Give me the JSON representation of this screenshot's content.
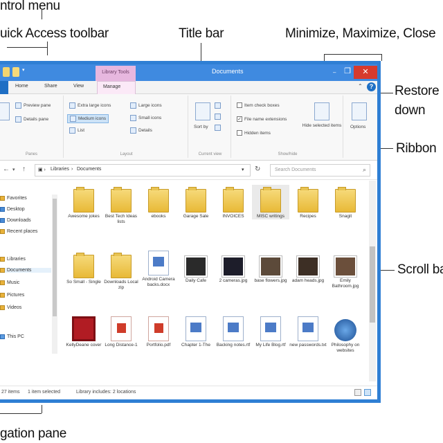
{
  "annotations": {
    "control_menu": "ntrol menu",
    "quick_access": "uick Access toolbar",
    "title_bar": "Title bar",
    "min_max_close": "Minimize, Maximize, Close",
    "restore_down_1": "Restore",
    "restore_down_2": "down",
    "ribbon": "Ribbon",
    "scroll_bar": "Scroll bar",
    "navigation_pane": "gation pane"
  },
  "window": {
    "title": "Documents",
    "contextual_tab": "Library Tools",
    "colors": {
      "frame": "#2f7fd4",
      "close": "#d73a2d",
      "contextual": "#e7b7df"
    }
  },
  "ribbon_tabs": [
    "Home",
    "Share",
    "View"
  ],
  "manage_tab": "Manage",
  "ribbon": {
    "panes": {
      "preview": "Preview pane",
      "details": "Details pane",
      "label": "Panes"
    },
    "layout": {
      "items": [
        "Extra large icons",
        "Large icons",
        "Medium icons",
        "Small icons",
        "List",
        "Details"
      ],
      "label": "Layout"
    },
    "current_view": {
      "sort_by": "Sort by",
      "label": "Current view"
    },
    "show_hide": {
      "item_check_boxes": "Item check boxes",
      "file_name_extensions": "File name extensions",
      "hidden_items": "Hidden items",
      "hide_selected": "Hide selected items",
      "label": "Show/hide"
    },
    "options": "Options"
  },
  "address": {
    "segments": [
      "Libraries",
      "Documents"
    ],
    "search_placeholder": "Search Documents"
  },
  "nav_pane": [
    "Favorites",
    "Desktop",
    "Downloads",
    "Recent places",
    "Libraries",
    "Documents",
    "Music",
    "Pictures",
    "Videos",
    "This PC"
  ],
  "items": [
    {
      "label": "Awesome jokes",
      "kind": "folder"
    },
    {
      "label": "Best Tech Ideas lists",
      "kind": "folder"
    },
    {
      "label": "ebooks",
      "kind": "folder"
    },
    {
      "label": "Garage Sale",
      "kind": "folder"
    },
    {
      "label": "INVOICES",
      "kind": "folder"
    },
    {
      "label": "MISC writings",
      "kind": "folder"
    },
    {
      "label": "Recipes",
      "kind": "folder"
    },
    {
      "label": "Snagit",
      "kind": "folder"
    },
    {
      "label": "So Small - Single",
      "kind": "folder"
    },
    {
      "label": "Downloads Local zip",
      "kind": "folder"
    },
    {
      "label": "Android Camera backs.docx",
      "kind": "doc"
    },
    {
      "label": "Daily Cafe",
      "kind": "photo"
    },
    {
      "label": "2 cameras.jpg",
      "kind": "photo"
    },
    {
      "label": "base flowers.jpg",
      "kind": "photo"
    },
    {
      "label": "adam heads.jpg",
      "kind": "photo"
    },
    {
      "label": "Emily Bathroom.jpg",
      "kind": "photo"
    },
    {
      "label": "KellyDeane cover",
      "kind": "red"
    },
    {
      "label": "Long Distance-1",
      "kind": "pdf"
    },
    {
      "label": "Portfolio.pdf",
      "kind": "pdf"
    },
    {
      "label": "Chapter 1-The",
      "kind": "doc"
    },
    {
      "label": "Backing notes.rtf",
      "kind": "doc"
    },
    {
      "label": "My Life Blog.rtf",
      "kind": "doc"
    },
    {
      "label": "new passwords.txt",
      "kind": "doc"
    },
    {
      "label": "Philosophy on websites",
      "kind": "globe"
    }
  ],
  "status": {
    "count": "27 items",
    "selected": "1 item selected",
    "library": "Library includes: 2 locations"
  }
}
